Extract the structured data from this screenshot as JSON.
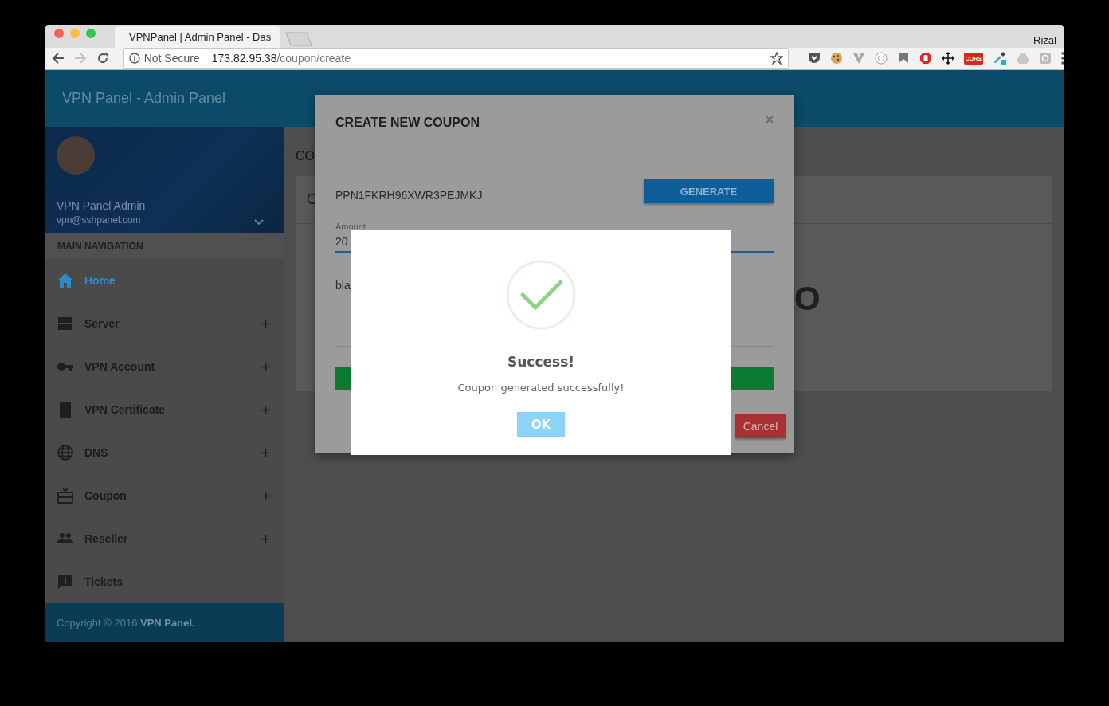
{
  "browser": {
    "tab_title": "VPNPanel | Admin Panel - Das",
    "profile": "Rizal",
    "security_label": "Not Secure",
    "url_host": "173.82.95.38",
    "url_path": "/coupon/create",
    "extension_label": "CORS"
  },
  "header": {
    "title": "VPN Panel - Admin Panel"
  },
  "user": {
    "name": "VPN Panel Admin",
    "email": "vpn@sshpanel.com"
  },
  "sidebar": {
    "heading": "MAIN NAVIGATION",
    "items": [
      {
        "label": "Home",
        "kind": "home",
        "selected": true,
        "expandable": false
      },
      {
        "label": "Server",
        "kind": "server",
        "selected": false,
        "expandable": true
      },
      {
        "label": "VPN Account",
        "kind": "key",
        "selected": false,
        "expandable": true
      },
      {
        "label": "VPN Certificate",
        "kind": "certificate",
        "selected": false,
        "expandable": true
      },
      {
        "label": "DNS",
        "kind": "globe",
        "selected": false,
        "expandable": true
      },
      {
        "label": "Coupon",
        "kind": "gift",
        "selected": false,
        "expandable": true
      },
      {
        "label": "Reseller",
        "kind": "people",
        "selected": false,
        "expandable": true
      },
      {
        "label": "Tickets",
        "kind": "ticket",
        "selected": false,
        "expandable": false
      }
    ]
  },
  "footer": {
    "copyright": "Copyright © 2016 **VPN Panel.**"
  },
  "page": {
    "title": "CO",
    "card_title": "C",
    "card_value": "O"
  },
  "coupon_modal": {
    "title": "CREATE NEW COUPON",
    "code": "PPN1FKRH96XWR3PEJMKJ",
    "generate_button": "GENERATE",
    "amount_label": "Amount",
    "amount_value": "20",
    "description_value": "bla",
    "cancel_button": "Cancel"
  },
  "success_dialog": {
    "title": "Success!",
    "message": "Coupon generated successfully!",
    "ok_button": "OK"
  }
}
